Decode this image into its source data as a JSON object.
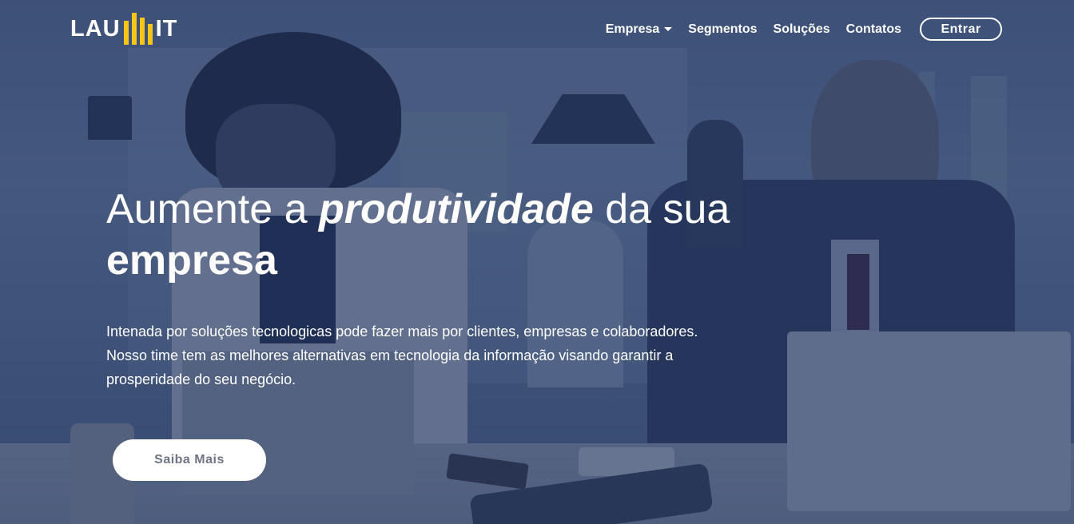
{
  "brand": {
    "prefix": "LAU",
    "suffix": "IT",
    "accent_color": "#f5c518"
  },
  "nav": {
    "items": [
      {
        "label": "Empresa",
        "dropdown": true
      },
      {
        "label": "Segmentos"
      },
      {
        "label": "Soluções"
      },
      {
        "label": "Contatos"
      }
    ],
    "login_label": "Entrar"
  },
  "hero": {
    "headline_part1": "Aumente a ",
    "headline_emphasis": "produtividade",
    "headline_part2": " da sua",
    "headline_line2": "empresa",
    "subtitle_line1": "Intenada por soluções tecnologicas pode fazer mais por clientes, empresas e colaboradores.",
    "subtitle_line2": "Nosso time tem as melhores alternativas em tecnologia da informação visando garantir a",
    "subtitle_line3": "prosperidade do seu negócio.",
    "cta_label": "Saiba Mais"
  }
}
